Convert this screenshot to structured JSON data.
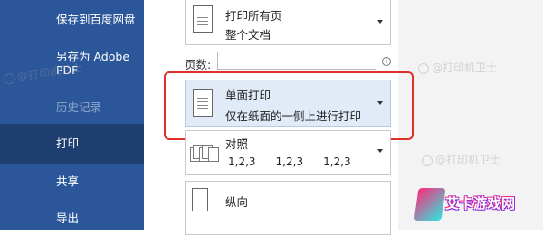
{
  "sidebar": {
    "items": [
      {
        "label": "保存到百度网盘"
      },
      {
        "label": "另存为 Adobe PDF"
      },
      {
        "label": "历史记录"
      },
      {
        "label": "打印"
      },
      {
        "label": "共享"
      },
      {
        "label": "导出"
      }
    ]
  },
  "settings": {
    "pages_dropdown": {
      "line1": "打印所有页",
      "line2": "整个文档"
    },
    "pages_label": "页数:",
    "pages_input": {
      "value": "",
      "placeholder": ""
    },
    "sides_dropdown": {
      "line1": "单面打印",
      "line2": "仅在纸面的一侧上进行打印"
    },
    "collate_dropdown": {
      "line1": "对照",
      "nums": [
        "1,2,3",
        "1,2,3",
        "1,2,3"
      ]
    },
    "orientation_dropdown": {
      "line1": "纵向"
    }
  },
  "watermarks": [
    "@打印机卫士",
    "@打印机卫士",
    "@打印机卫士"
  ],
  "logo": {
    "text": "艾卡游戏网"
  },
  "colors": {
    "sidebar_bg": "#2b579a",
    "sidebar_active": "#1e3e70",
    "highlight_bg": "#e1ebf8",
    "annotation_red": "#e0302a"
  }
}
